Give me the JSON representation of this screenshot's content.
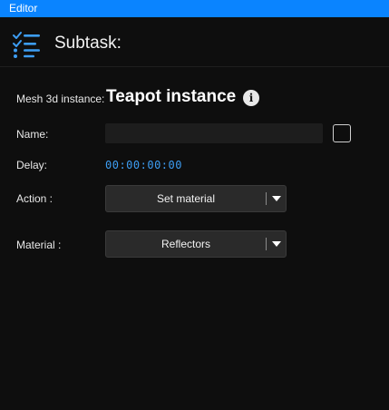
{
  "window": {
    "title": "Editor"
  },
  "header": {
    "title": "Subtask:",
    "icon": "task-list-icon"
  },
  "mesh": {
    "label": "Mesh 3d instance:",
    "value": "Teapot instance",
    "info_icon": "info-icon"
  },
  "name": {
    "label": "Name:",
    "value": "",
    "checked": false
  },
  "delay": {
    "label": "Delay:",
    "value": "00:00:00:00"
  },
  "action": {
    "label": "Action :",
    "selected": "Set material"
  },
  "material": {
    "label": "Material :",
    "selected": "Reflectors"
  },
  "colors": {
    "accent": "#0a84ff",
    "background": "#0e0e0e",
    "delay_text": "#3d9df2",
    "control": "#2a2a2a"
  }
}
